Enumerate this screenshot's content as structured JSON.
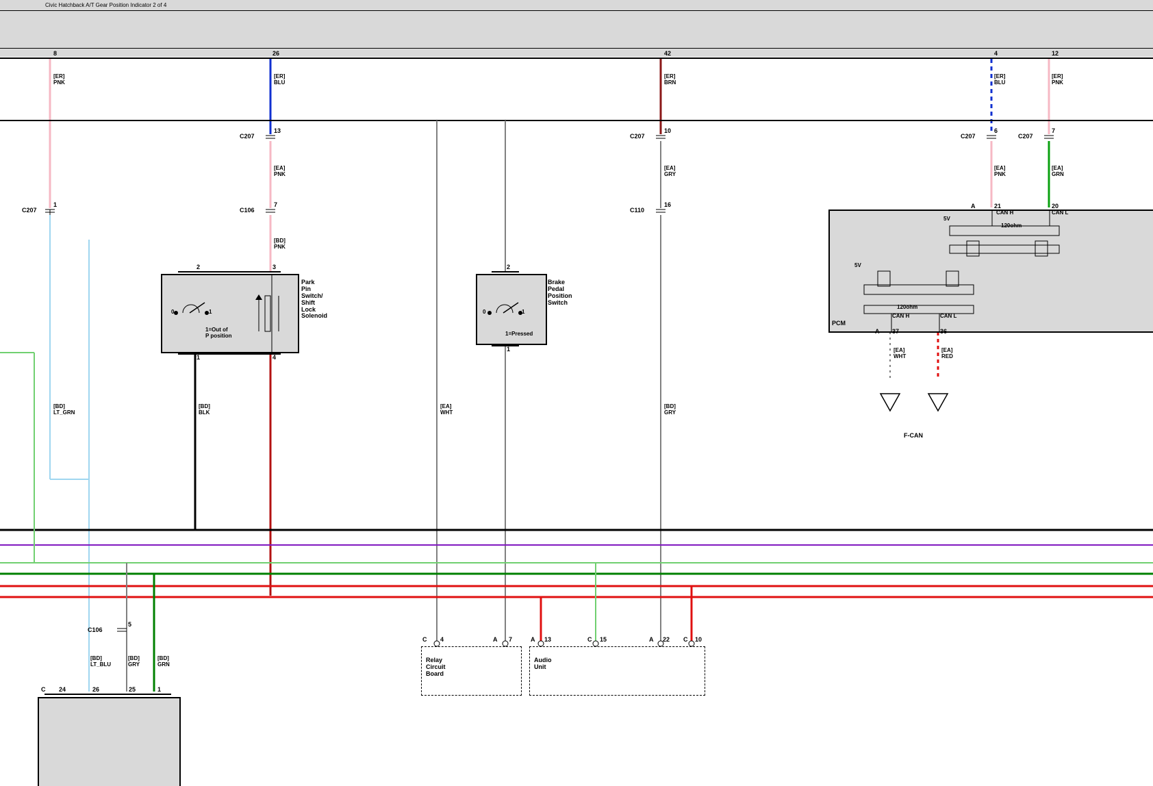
{
  "title": "Civic Hatchback A/T Gear Position Indicator 2 of 4",
  "wires": {
    "w8": {
      "pin": "8",
      "tag1": "[ER]",
      "col1": "PNK",
      "conn1": "C207",
      "connPin1": "1",
      "tag2": "[BD]",
      "col2": "LT_GRN"
    },
    "w26": {
      "pin": "26",
      "tag1": "[ER]",
      "col1": "BLU",
      "conn1": "C207",
      "connPin1": "13",
      "tag2": "[EA]",
      "col2": "PNK",
      "conn2": "C106",
      "connPin2": "7",
      "tag3": "[BD]",
      "col3": "PNK",
      "tag4": "[BD]",
      "col4": "BLK"
    },
    "w42": {
      "pin": "42",
      "tag1": "[ER]",
      "col1": "BRN",
      "conn1": "C207",
      "connPin1": "10",
      "tag2": "[EA]",
      "col2": "GRY",
      "conn2": "C110",
      "connPin2": "16",
      "tag3": "[BD]",
      "col3": "GRY"
    },
    "w4": {
      "pin": "4",
      "tag": "[ER]",
      "col": "BLU",
      "conn": "C207",
      "connPin": "6",
      "tag2": "[EA]",
      "col2": "PNK"
    },
    "w12": {
      "pin": "12",
      "tag": "[ER]",
      "col": "PNK",
      "conn": "C207",
      "connPin": "7",
      "tag2": "[EA]",
      "col2": "GRN"
    },
    "wEA_WHT": {
      "tag": "[EA]",
      "col": "WHT"
    }
  },
  "blocks": {
    "park": {
      "title": "Park\nPin\nSwitch/\nShift\nLock\nSolenoid",
      "sw_off": "0",
      "sw_on": "1",
      "note": "1=Out of\nP position",
      "pins": [
        "2",
        "3",
        "1",
        "4"
      ]
    },
    "brake": {
      "title": "Brake\nPedal\nPosition\nSwitch",
      "sw_off": "0",
      "sw_on": "1",
      "note": "1=Pressed",
      "pins": [
        "2",
        "1"
      ]
    },
    "relay": {
      "title": "Relay\nCircuit\nBoard",
      "c": "C",
      "p4": "4",
      "a1": "A",
      "p7": "7"
    },
    "audio": {
      "title": "Audio\nUnit",
      "a1p": "13",
      "c1p": "15",
      "a2p": "22",
      "c2p": "10"
    },
    "pcm": {
      "title": "PCM",
      "v5": "5V",
      "canh": "CAN H",
      "canl": "CAN L",
      "r": "120ohm",
      "a21": "21",
      "a20": "20",
      "a37": "37",
      "a36": "36",
      "a": "A",
      "tag37": "[EA]",
      "col37": "WHT",
      "tag36": "[EA]",
      "col36": "RED",
      "fcan": "F-CAN"
    }
  },
  "bottom": {
    "c106": {
      "name": "C106",
      "pin": "5",
      "tag1": "[BD]",
      "col1": "LT_BLU",
      "tag2": "[BD]",
      "col2": "GRY",
      "tag3": "[BD]",
      "col3": "GRN"
    },
    "c": {
      "c": "C",
      "p24": "24",
      "p26": "26",
      "p25": "25",
      "p1": "1"
    }
  }
}
